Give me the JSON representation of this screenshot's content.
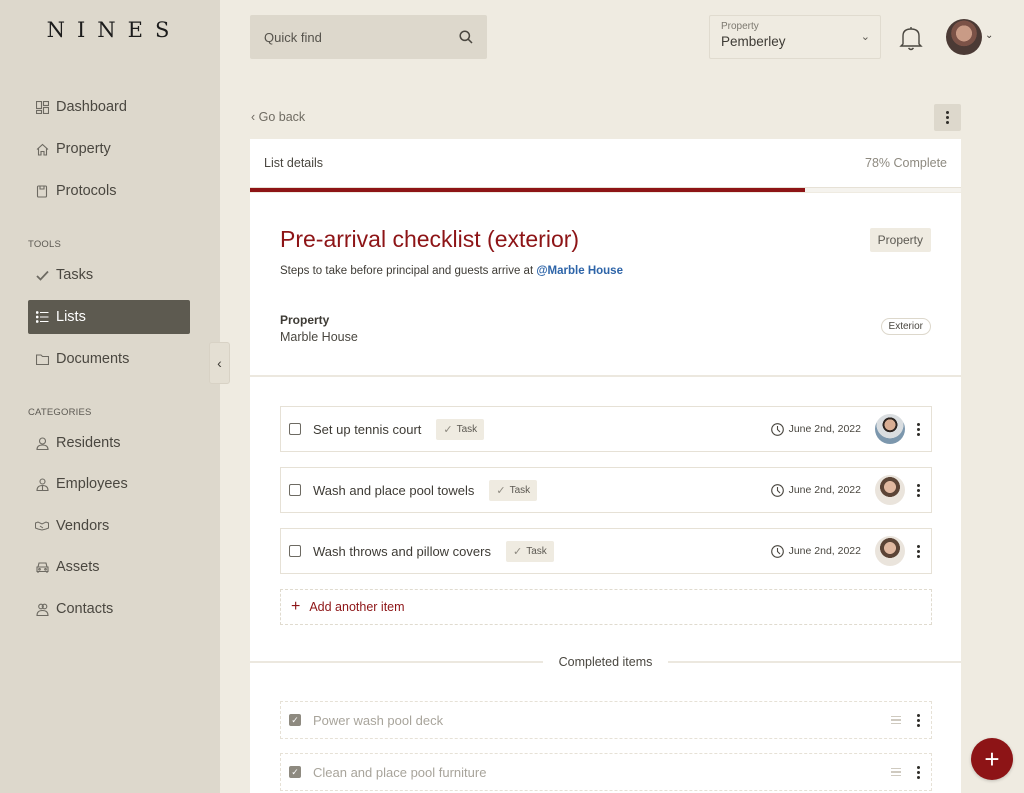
{
  "app": {
    "logo": "NINES"
  },
  "sidebar": {
    "main_items": [
      {
        "label": "Dashboard",
        "icon": "dashboard-icon"
      },
      {
        "label": "Property",
        "icon": "home-icon"
      },
      {
        "label": "Protocols",
        "icon": "clipboard-icon"
      }
    ],
    "tools_label": "TOOLS",
    "tools_items": [
      {
        "label": "Tasks",
        "icon": "check-icon"
      },
      {
        "label": "Lists",
        "icon": "list-icon",
        "active": true
      },
      {
        "label": "Documents",
        "icon": "folder-icon"
      }
    ],
    "categories_label": "CATEGORIES",
    "category_items": [
      {
        "label": "Residents",
        "icon": "person-icon"
      },
      {
        "label": "Employees",
        "icon": "employee-icon"
      },
      {
        "label": "Vendors",
        "icon": "handshake-icon"
      },
      {
        "label": "Assets",
        "icon": "car-icon"
      },
      {
        "label": "Contacts",
        "icon": "contacts-icon"
      }
    ]
  },
  "header": {
    "search_placeholder": "Quick find",
    "property_select": {
      "label": "Property",
      "value": "Pemberley"
    }
  },
  "page": {
    "go_back": "‹ Go back",
    "list_details_label": "List details",
    "progress": {
      "percent": 78,
      "label": "78% Complete"
    },
    "title": "Pre-arrival checklist (exterior)",
    "subtitle_prefix": "Steps to take before principal and guests arrive at ",
    "subtitle_mention": "@Marble House",
    "type_tag": "Property",
    "meta": {
      "label": "Property",
      "value": "Marble House"
    },
    "category_chip": "Exterior",
    "items": [
      {
        "text": "Set up tennis court",
        "tag": "Task",
        "date": "June 2nd, 2022",
        "checked": false
      },
      {
        "text": "Wash and place pool towels",
        "tag": "Task",
        "date": "June 2nd, 2022",
        "checked": false
      },
      {
        "text": "Wash throws and pillow covers",
        "tag": "Task",
        "date": "June 2nd, 2022",
        "checked": false
      }
    ],
    "add_item_label": "Add another item",
    "completed_label": "Completed items",
    "completed_items": [
      {
        "text": "Power wash pool deck",
        "checked": true
      },
      {
        "text": "Clean and place pool furniture",
        "checked": true
      }
    ]
  },
  "colors": {
    "accent": "#8d1416",
    "mention": "#2d64a8",
    "sidebar_bg": "#ddd8cc",
    "page_bg": "#efebe1"
  }
}
